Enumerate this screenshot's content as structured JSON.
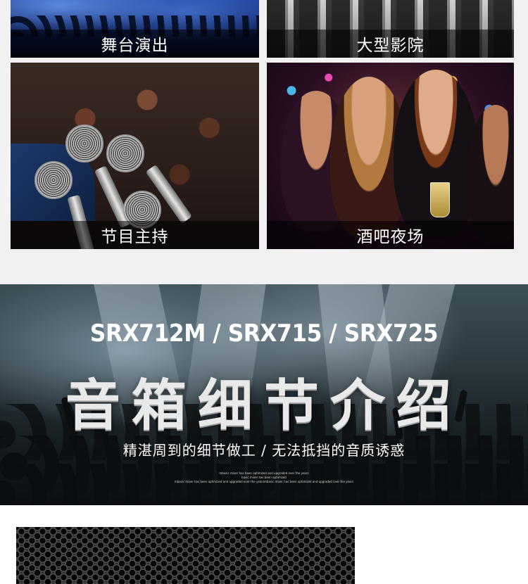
{
  "gallery": {
    "tiles": [
      {
        "caption": "舞台演出"
      },
      {
        "caption": "大型影院"
      },
      {
        "caption": "节目主持"
      },
      {
        "caption": "酒吧夜场"
      }
    ]
  },
  "banner": {
    "title": "SRX712M / SRX715 / SRX725",
    "heading": "音箱细节介绍",
    "subtitle": "精湛周到的细节做工 / 无法抵挡的音质诱惑",
    "small_lines": [
      "mbasic mixer has been optimized and upgraded over the years",
      "basic mixer has been optimized",
      "mbasic mixer has been optimized and upgraded over the yearsmbasic mixer has been optimized and upgraded over the years"
    ]
  },
  "colors": {
    "gallery_background": "#f1f1f1",
    "caption_bar": "rgba(0,0,0,0.55)",
    "banner_text": "#ffffff"
  }
}
